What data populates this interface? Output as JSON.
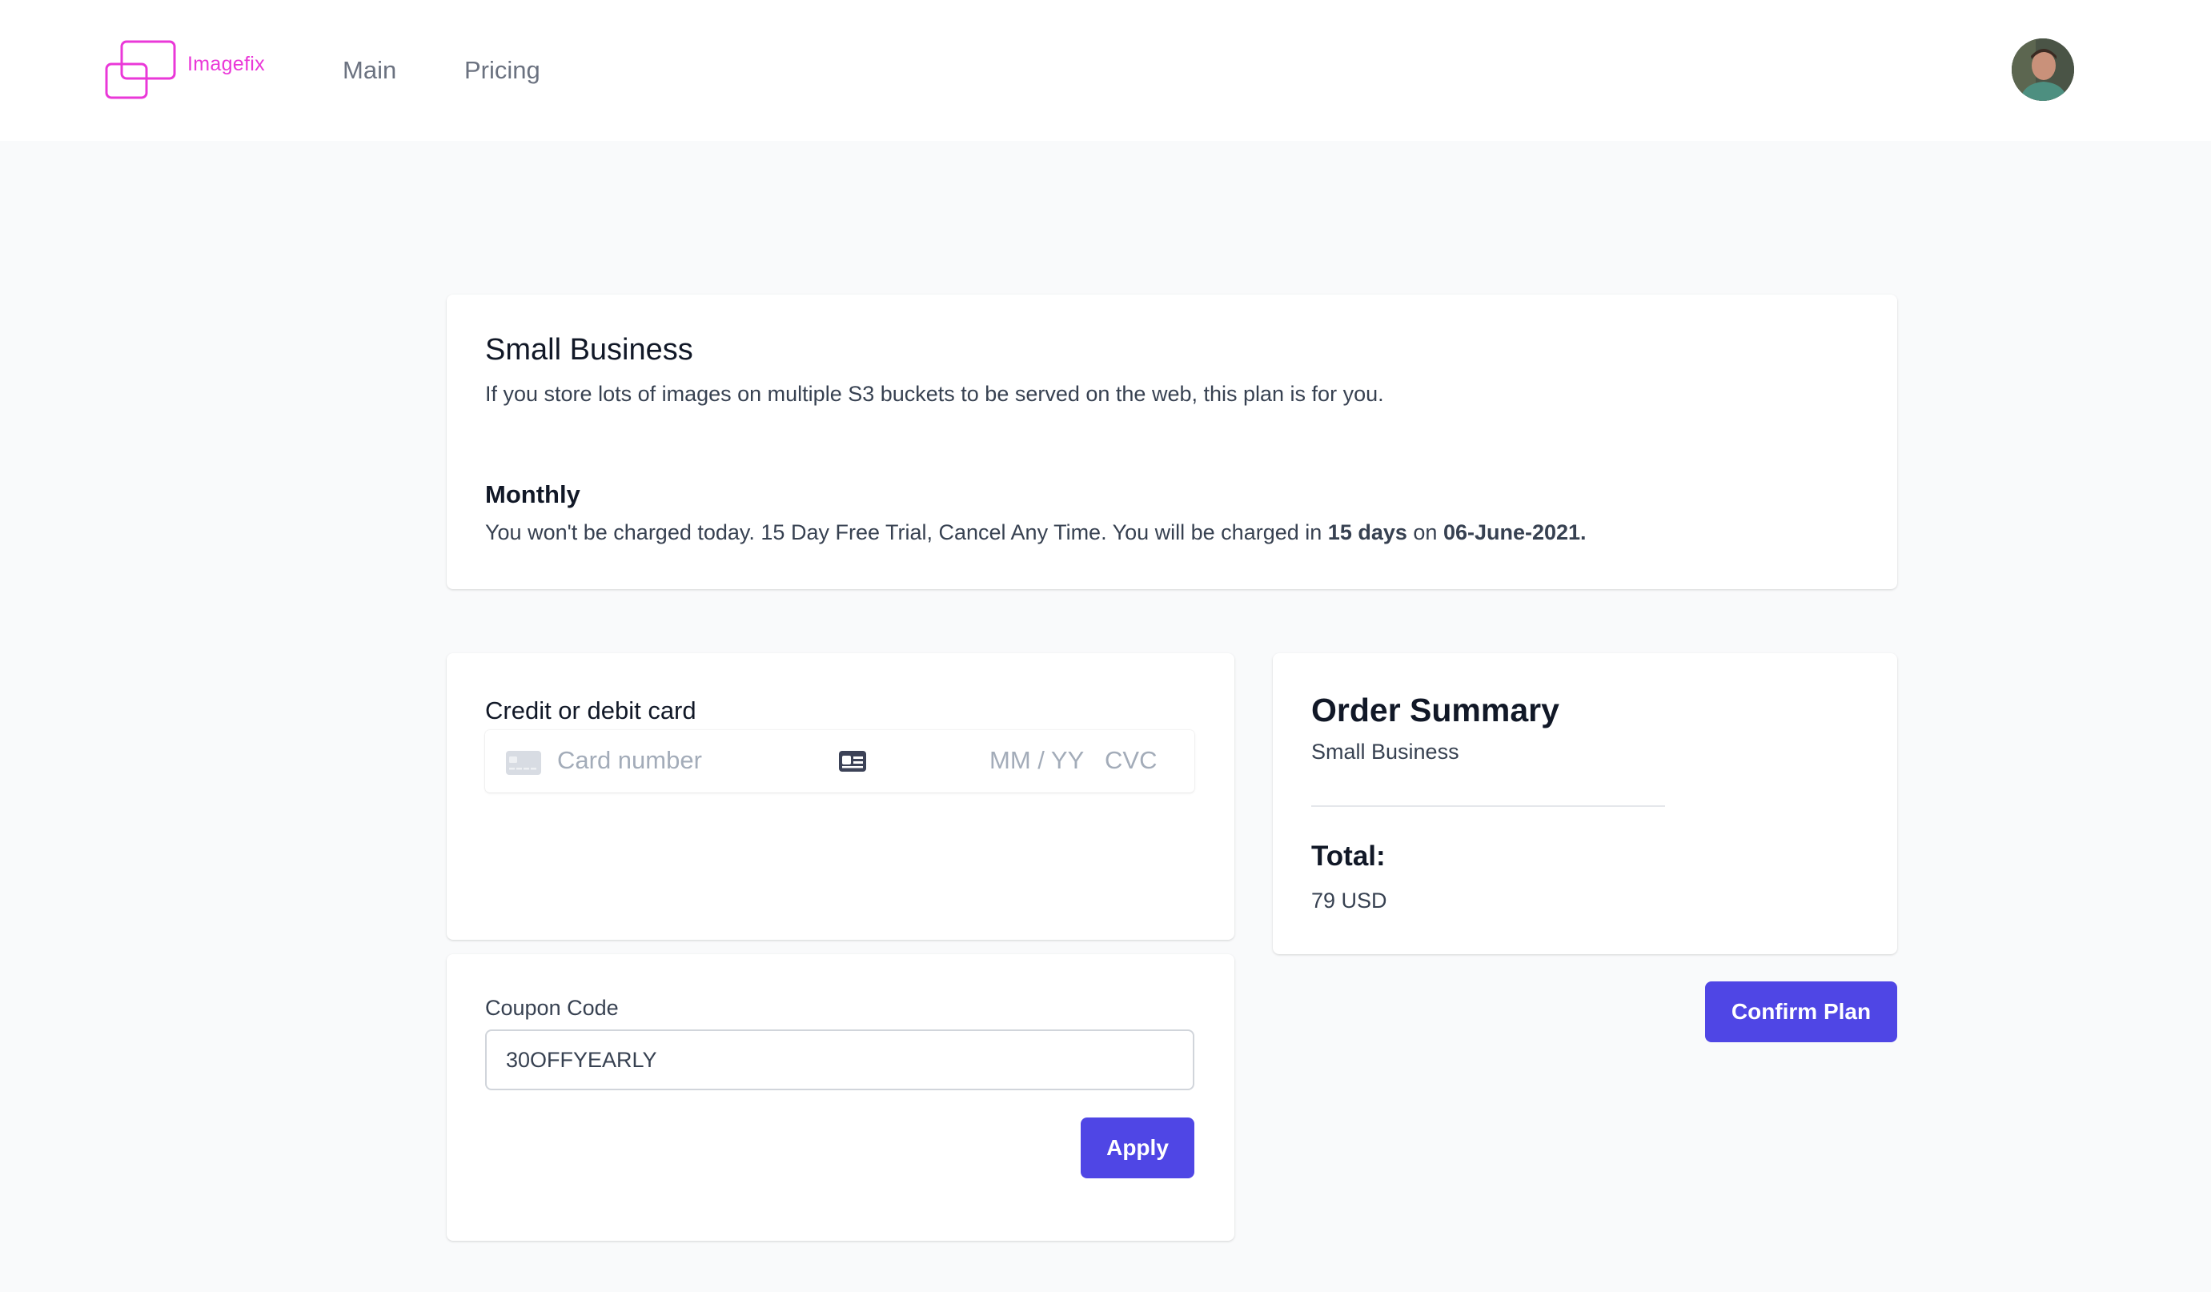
{
  "brand": {
    "name": "Imagefix",
    "color": "#ea38d8"
  },
  "nav": {
    "links": [
      {
        "label": "Main"
      },
      {
        "label": "Pricing"
      }
    ]
  },
  "plan": {
    "title": "Small Business",
    "description": "If you store lots of images on multiple S3 buckets to be served on the web, this plan is for you.",
    "period_title": "Monthly",
    "trial_text": "You won't be charged today. 15 Day Free Trial, Cancel Any Time. You will be charged in",
    "charge_days": "15 days",
    "on_text": "on",
    "charge_date": "06-June-2021."
  },
  "payment": {
    "label": "Credit or debit card",
    "card_number_placeholder": "Card number",
    "expiry_placeholder": "MM / YY",
    "cvc_placeholder": "CVC"
  },
  "coupon": {
    "label": "Coupon Code",
    "value": "30OFFYEARLY",
    "apply_label": "Apply"
  },
  "summary": {
    "title": "Order Summary",
    "plan_name": "Small Business",
    "total_label": "Total:",
    "total_value": "79 USD",
    "confirm_label": "Confirm Plan"
  },
  "colors": {
    "accent": "#4f46e5",
    "background": "#f9fafb"
  }
}
